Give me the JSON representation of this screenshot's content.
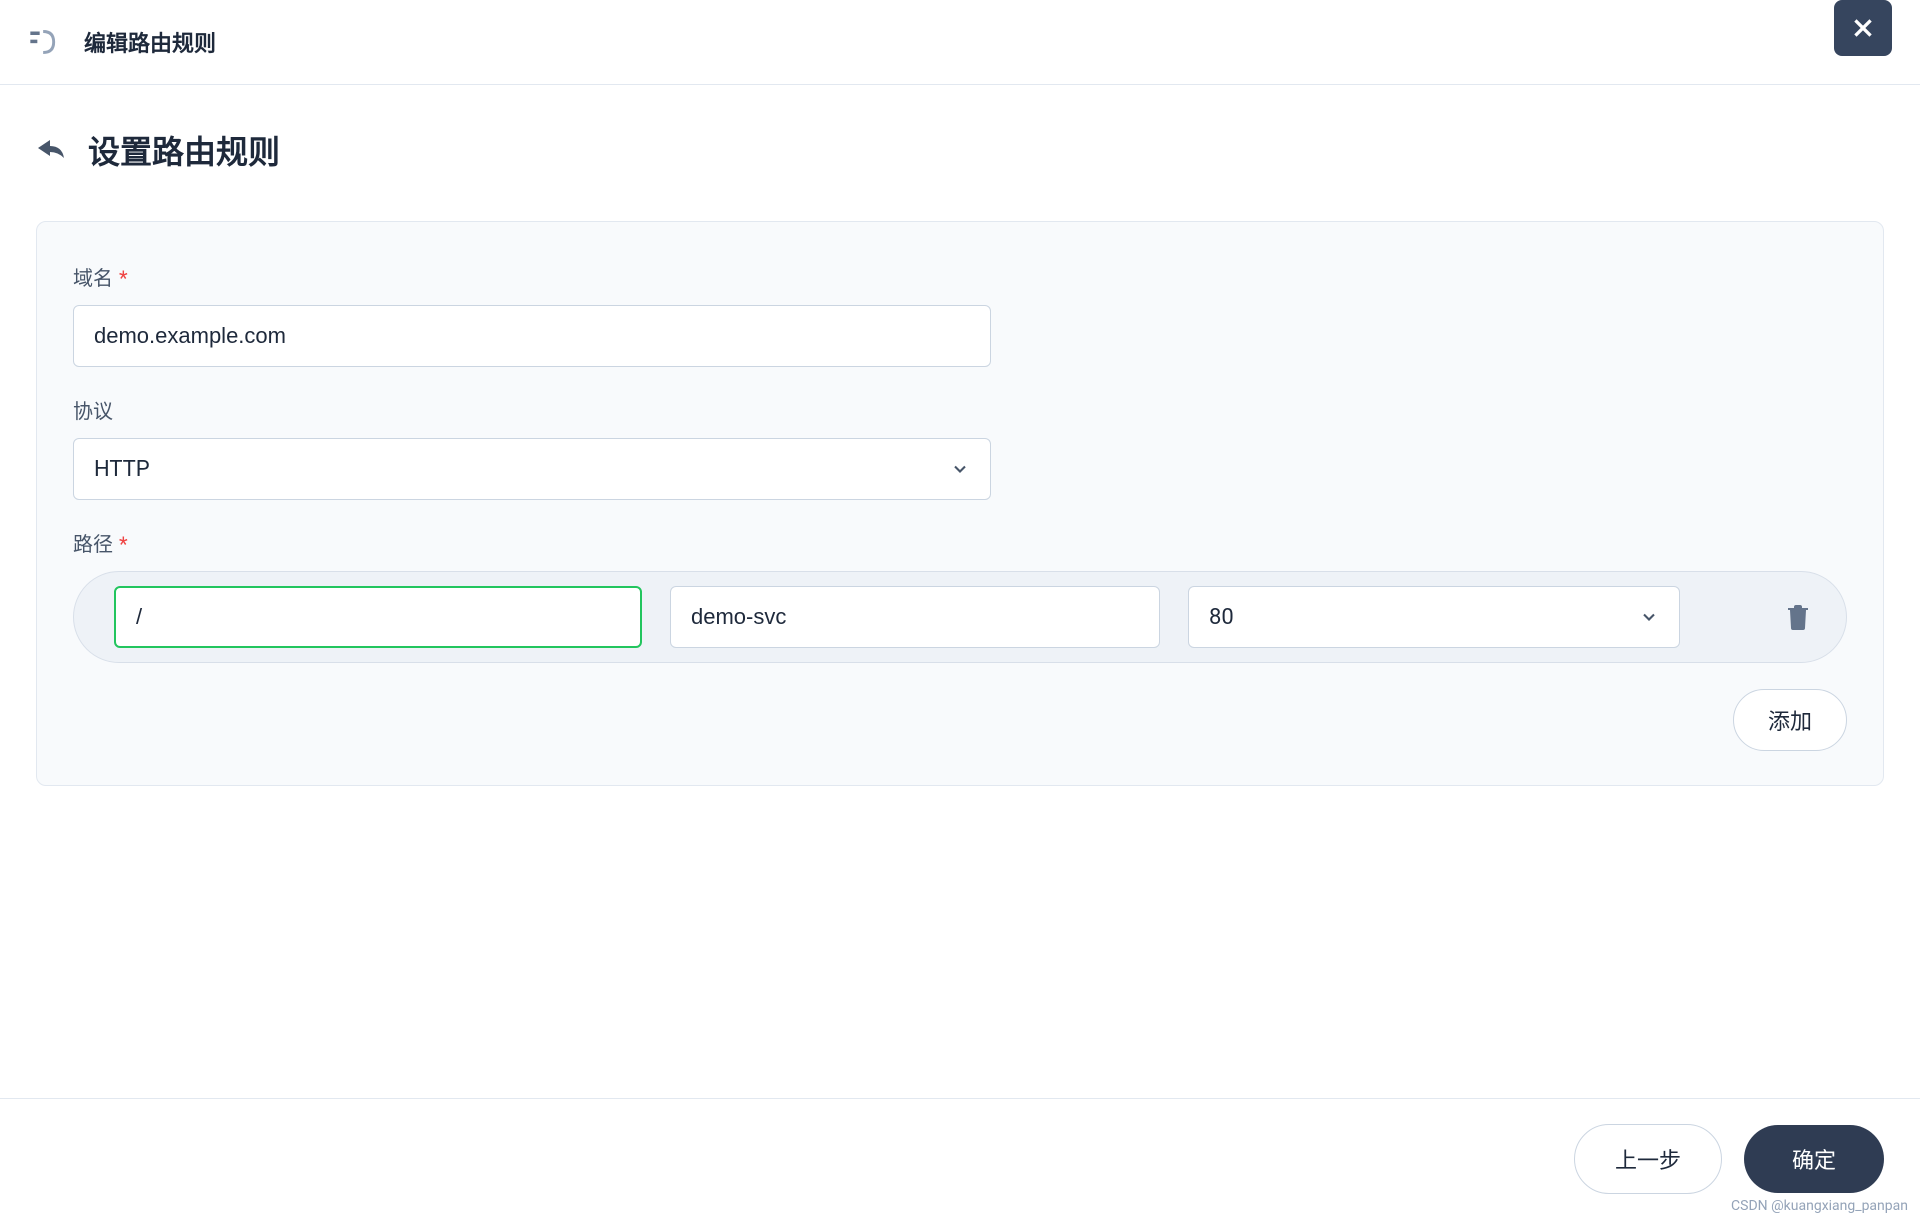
{
  "header": {
    "title": "编辑路由规则"
  },
  "page": {
    "heading": "设置路由规则"
  },
  "form": {
    "domain": {
      "label": "域名",
      "value": "demo.example.com"
    },
    "protocol": {
      "label": "协议",
      "value": "HTTP"
    },
    "paths": {
      "label": "路径",
      "rows": [
        {
          "path": "/",
          "service": "demo-svc",
          "port": "80"
        }
      ],
      "add_label": "添加"
    }
  },
  "footer": {
    "previous_label": "上一步",
    "confirm_label": "确定"
  },
  "watermark": "CSDN @kuangxiang_panpan"
}
